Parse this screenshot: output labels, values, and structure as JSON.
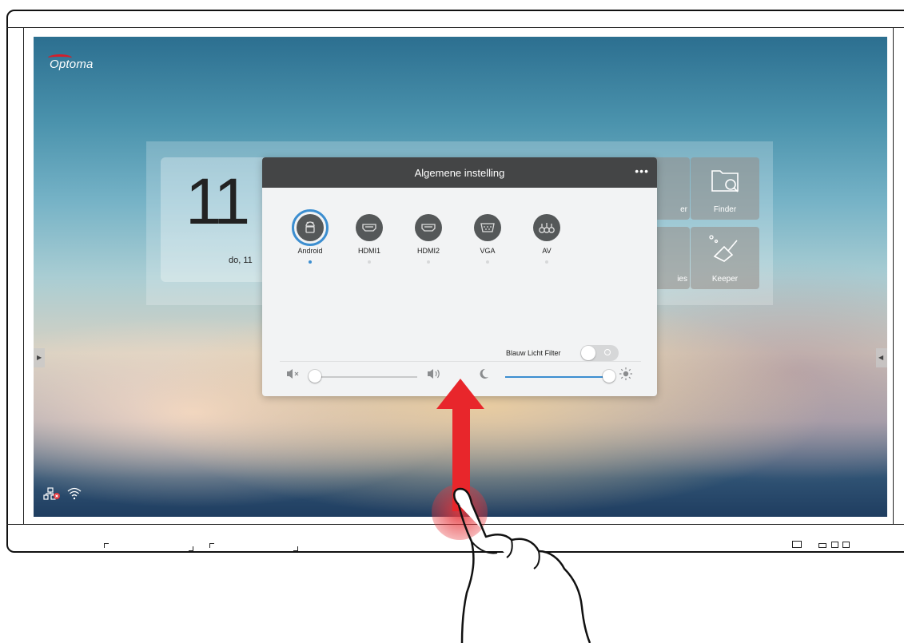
{
  "brand": {
    "logo": "Optoma",
    "logo_color": "#d21f2b"
  },
  "home": {
    "clock_time": "11",
    "clock_date": "do, 11",
    "tiles": [
      {
        "label": "er"
      },
      {
        "label": "Finder"
      },
      {
        "label": "ies"
      },
      {
        "label": "Keeper"
      }
    ]
  },
  "dialog": {
    "title": "Algemene instelling",
    "more_label": "•••",
    "sources": [
      {
        "label": "Android",
        "icon": "android-icon",
        "active": true
      },
      {
        "label": "HDMI1",
        "icon": "hdmi-icon",
        "active": false
      },
      {
        "label": "HDMI2",
        "icon": "hdmi-icon",
        "active": false
      },
      {
        "label": "VGA",
        "icon": "vga-icon",
        "active": false
      },
      {
        "label": "AV",
        "icon": "av-icon",
        "active": false
      }
    ],
    "blue_light_filter": {
      "label": "Blauw Licht Filter",
      "enabled": false
    },
    "volume": {
      "value": 0.0,
      "mute_icon": "volume-mute-icon",
      "max_icon": "volume-up-icon"
    },
    "brightness": {
      "value": 1.0,
      "min_icon": "moon-icon",
      "max_icon": "sun-icon",
      "accent": "#3c8ed0"
    }
  },
  "gesture": {
    "type": "swipe-up",
    "color": "#e8262b"
  },
  "status": {
    "network_icon": "network-disconnected-icon",
    "wifi_icon": "wifi-icon"
  }
}
